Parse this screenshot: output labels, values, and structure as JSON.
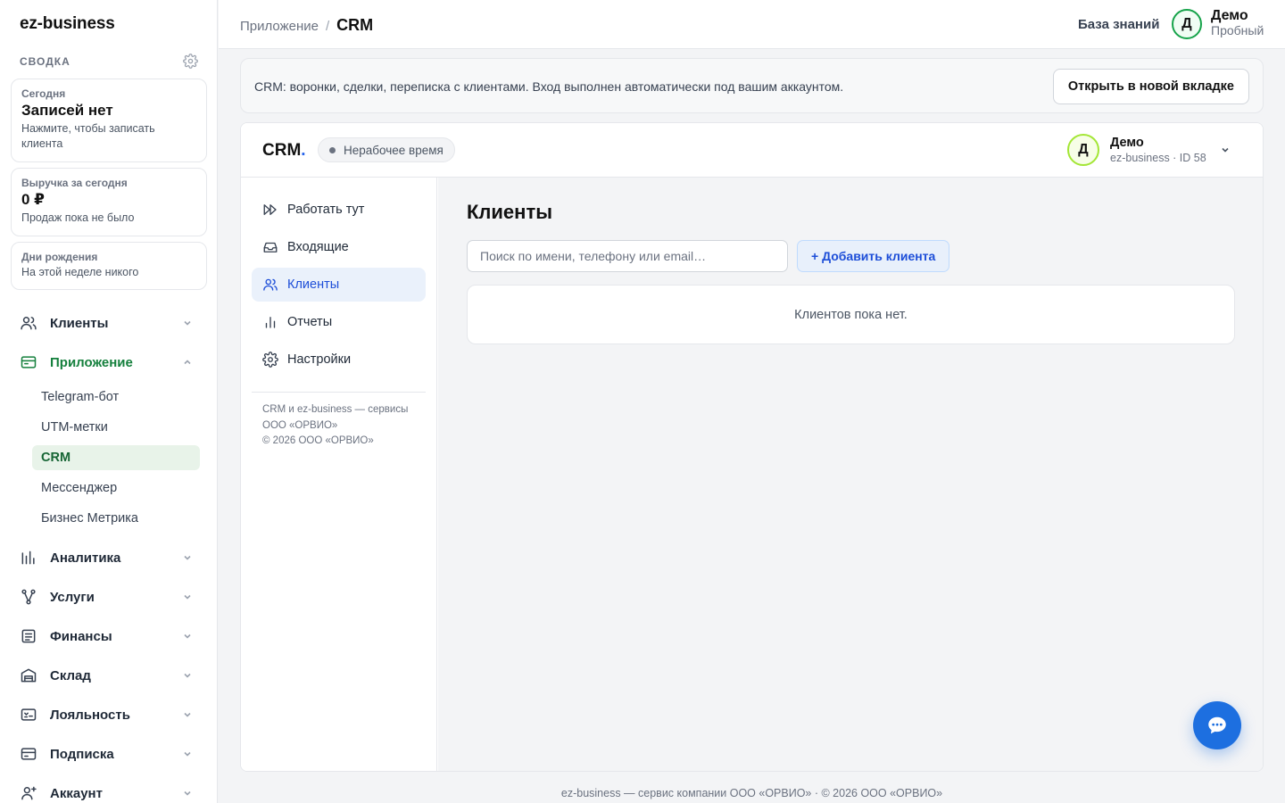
{
  "app": {
    "logo": "ez-business"
  },
  "summary": {
    "title": "СВОДКА",
    "today": {
      "label": "Сегодня",
      "value": "Записей нет",
      "hint": "Нажмите, чтобы записать клиента"
    },
    "revenue": {
      "label": "Выручка за сегодня",
      "value": "0 ₽",
      "hint": "Продаж пока не было"
    },
    "birthdays": {
      "label": "Дни рождения",
      "hint": "На этой неделе никого"
    }
  },
  "sidebar": {
    "items": [
      {
        "label": "Клиенты",
        "icon": "users-icon"
      },
      {
        "label": "Приложение",
        "icon": "app-window-icon",
        "expanded": true
      },
      {
        "label": "Аналитика",
        "icon": "bar-chart-icon"
      },
      {
        "label": "Услуги",
        "icon": "services-icon"
      },
      {
        "label": "Финансы",
        "icon": "document-icon"
      },
      {
        "label": "Склад",
        "icon": "warehouse-icon"
      },
      {
        "label": "Лояльность",
        "icon": "loyalty-card-icon"
      },
      {
        "label": "Подписка",
        "icon": "credit-card-icon"
      },
      {
        "label": "Аккаунт",
        "icon": "user-plus-icon"
      }
    ],
    "sub_items": [
      {
        "label": "Telegram-бот"
      },
      {
        "label": "UTM-метки"
      },
      {
        "label": "CRM",
        "active": true
      },
      {
        "label": "Мессенджер"
      },
      {
        "label": "Бизнес Метрика"
      }
    ]
  },
  "header": {
    "breadcrumb_parent": "Приложение",
    "breadcrumb_sep": "/",
    "breadcrumb_current": "CRM",
    "knowledge_base": "База знаний",
    "user": {
      "initial": "Д",
      "name": "Демо",
      "role": "Пробный"
    }
  },
  "infobar": {
    "text": "CRM: воронки, сделки, переписка с клиентами. Вход выполнен автоматически под вашим аккаунтом.",
    "open_button": "Открыть в новой вкладке"
  },
  "crm": {
    "logo": "CRM",
    "logo_dot": ".",
    "status": "Нерабочее время",
    "user": {
      "initial": "Д",
      "name": "Демо",
      "info": "ez-business · ID 58"
    },
    "nav": [
      {
        "label": "Работать тут",
        "icon": "fast-forward-icon"
      },
      {
        "label": "Входящие",
        "icon": "inbox-icon"
      },
      {
        "label": "Клиенты",
        "icon": "users-icon",
        "active": true
      },
      {
        "label": "Отчеты",
        "icon": "bar-chart-icon"
      },
      {
        "label": "Настройки",
        "icon": "gear-icon"
      }
    ],
    "footer_line1": "CRM и ez-business — сервисы",
    "footer_line2": "ООО «ОРВИО»",
    "footer_line3": "© 2026 ООО «ОРВИО»",
    "page_title": "Клиенты",
    "search_placeholder": "Поиск по имени, телефону или email…",
    "add_button": "+ Добавить клиента",
    "empty_text": "Клиентов пока нет."
  },
  "footer": {
    "text": "ez-business — сервис компании ООО «ОРВИО» · © 2026 ООО «ОРВИО»"
  },
  "colors": {
    "brand_green": "#15803d",
    "accent_blue": "#1d6fe0",
    "active_sub_bg": "#e8f3e9"
  }
}
